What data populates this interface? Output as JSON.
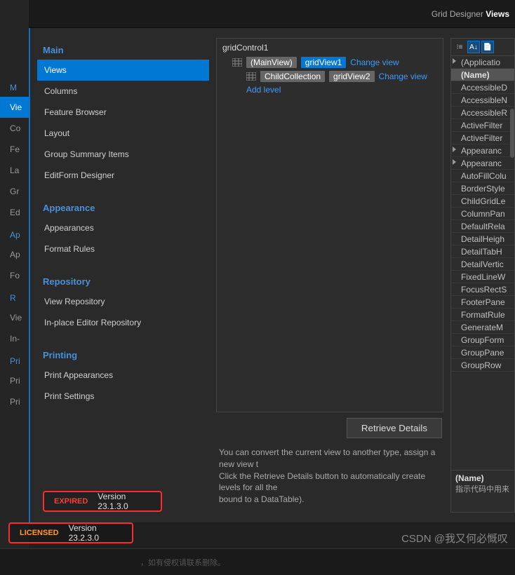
{
  "title": {
    "prefix": "Grid Designer",
    "section": "Views"
  },
  "bgSidebar": {
    "header1": "M",
    "items1": [
      "Vie",
      "Co",
      "Fe",
      "La",
      "Gr",
      "Ed"
    ],
    "header2": "Ap",
    "items2": [
      "Ap",
      "Fo"
    ],
    "header3": "R",
    "items3": [
      "Vie",
      "In-"
    ],
    "header4": "Pri",
    "items4": [
      "Pri",
      "Pri"
    ]
  },
  "nav": {
    "main": {
      "header": "Main",
      "items": [
        "Views",
        "Columns",
        "Feature Browser",
        "Layout",
        "Group Summary Items",
        "EditForm Designer"
      ]
    },
    "appearance": {
      "header": "Appearance",
      "items": [
        "Appearances",
        "Format Rules"
      ]
    },
    "repository": {
      "header": "Repository",
      "items": [
        "View Repository",
        "In-place Editor Repository"
      ]
    },
    "printing": {
      "header": "Printing",
      "items": [
        "Print Appearances",
        "Print Settings"
      ]
    }
  },
  "tree": {
    "root": "gridControl1",
    "row1": {
      "main": "(MainView)",
      "view": "gridView1",
      "action": "Change view"
    },
    "row2": {
      "child": "ChildCollection",
      "view": "gridView2",
      "action": "Change view"
    },
    "addLevel": "Add level"
  },
  "retrieveBtn": "Retrieve Details",
  "hint": "You can convert the current view to another type, assign a new view t\nClick the Retrieve Details button to automatically create levels for all the\nbound to a DataTable).",
  "props": {
    "items": [
      {
        "label": "(Applicatio",
        "caret": true
      },
      {
        "label": "(Name)",
        "bold": true,
        "sel": true
      },
      {
        "label": "AccessibleD"
      },
      {
        "label": "AccessibleN"
      },
      {
        "label": "AccessibleR"
      },
      {
        "label": "ActiveFilter"
      },
      {
        "label": "ActiveFilter"
      },
      {
        "label": "Appearanc",
        "caret": true
      },
      {
        "label": "Appearanc",
        "caret": true
      },
      {
        "label": "AutoFillColu"
      },
      {
        "label": "BorderStyle"
      },
      {
        "label": "ChildGridLe"
      },
      {
        "label": "ColumnPan"
      },
      {
        "label": "DefaultRela"
      },
      {
        "label": "DetailHeigh"
      },
      {
        "label": "DetailTabH"
      },
      {
        "label": "DetailVertic"
      },
      {
        "label": "FixedLineW"
      },
      {
        "label": "FocusRectS"
      },
      {
        "label": "FooterPane"
      },
      {
        "label": "FormatRule"
      },
      {
        "label": "GenerateM"
      },
      {
        "label": "GroupForm"
      },
      {
        "label": "GroupPane"
      },
      {
        "label": "GroupRow"
      }
    ],
    "descName": "(Name)",
    "descText": "指示代码中用来"
  },
  "license": {
    "expired": {
      "status": "EXPIRED",
      "version": "Version 23.1.3.0"
    },
    "licensed": {
      "status": "LICENSED",
      "version": "Version 23.2.3.0"
    }
  },
  "watermark": "CSDN @我又何必慨叹",
  "bottomText": "，如有侵权请联系删除。"
}
